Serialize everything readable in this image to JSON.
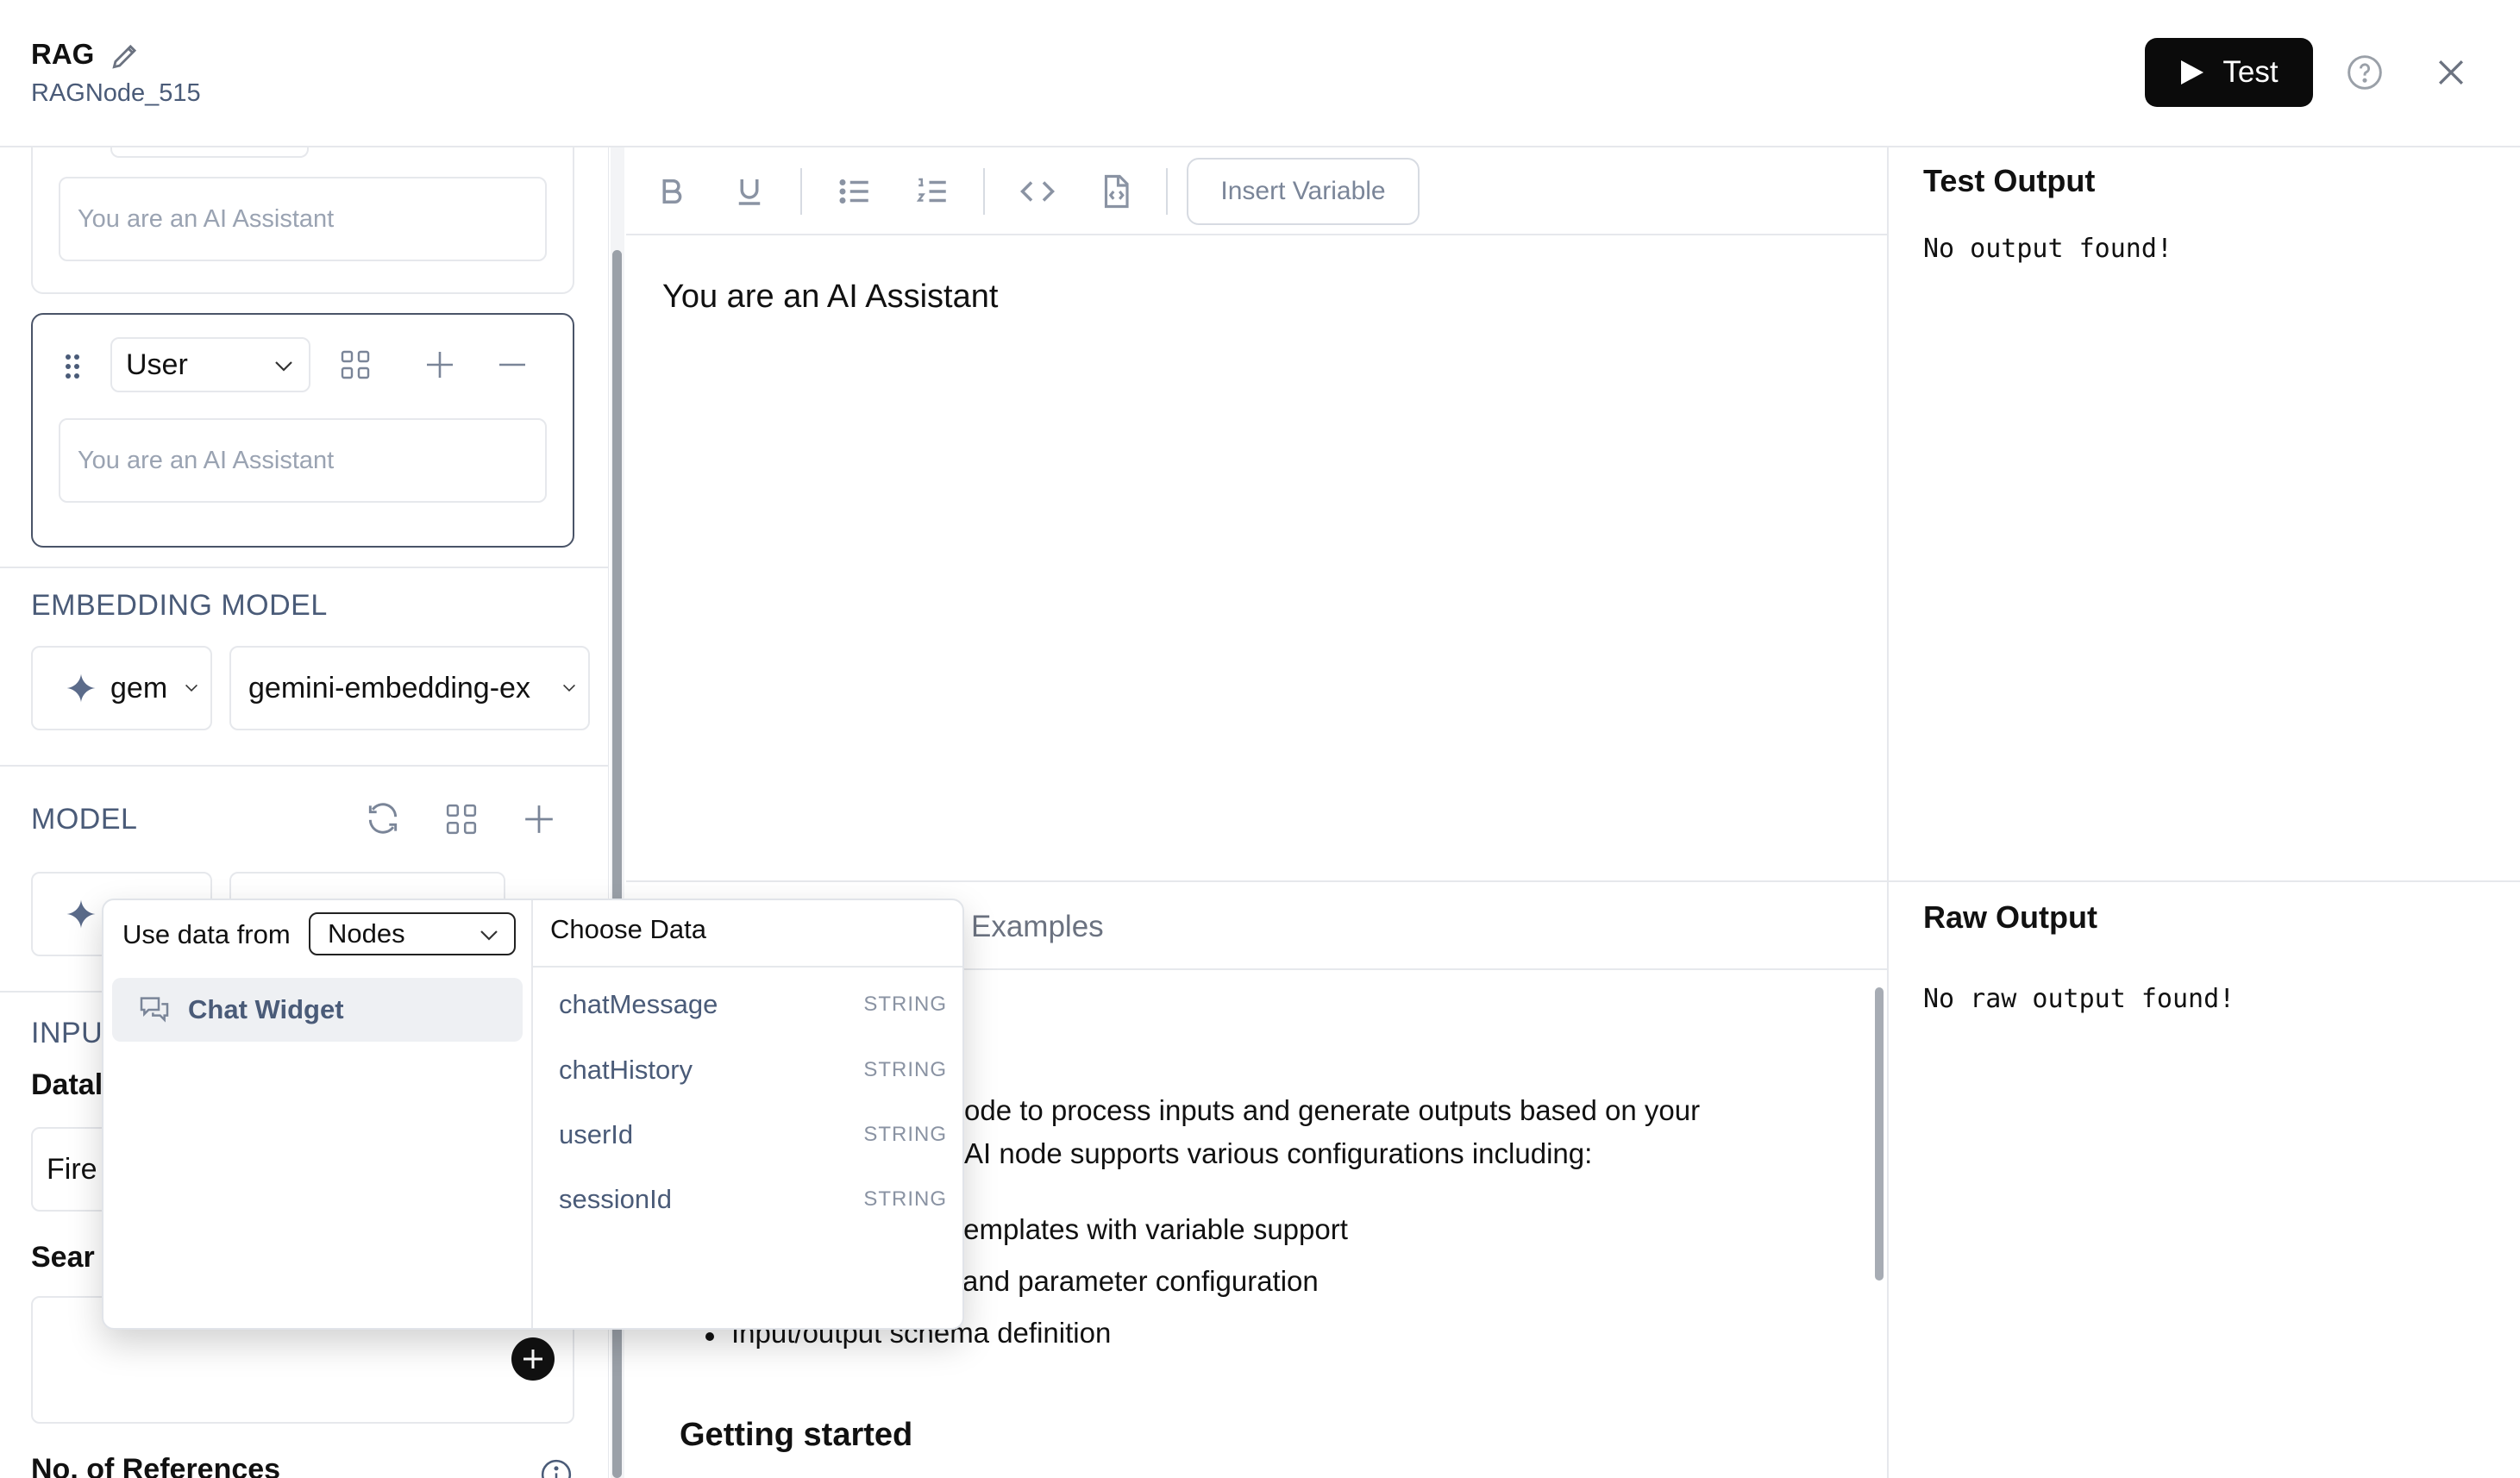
{
  "header": {
    "title": "RAG",
    "subtitle": "RAGNode_515",
    "test_label": "Test"
  },
  "left": {
    "system_message_placeholder": "You are an AI Assistant",
    "user_role": "User",
    "user_message_placeholder": "You are an AI Assistant",
    "embedding_label": "EMBEDDING MODEL",
    "embedding_provider": "gem",
    "embedding_model": "gemini-embedding-ex",
    "model_label": "MODEL",
    "inputs_label": "INPU",
    "datasource_label": "Datal",
    "datasource_value": "Fire",
    "search_label": "Sear",
    "references_label": "No. of References"
  },
  "editor": {
    "insert_variable": "Insert Variable",
    "content": "You are an AI Assistant"
  },
  "docs": {
    "tab_examples": "Examples",
    "line1": "ode to process inputs and generate outputs based on your",
    "line2": "AI node supports various configurations including:",
    "bullet1": "templates with variable support",
    "bullet2": "and parameter configuration",
    "bullet3": "Input/output schema definition",
    "heading_getting_started": "Getting started"
  },
  "output": {
    "test_title": "Test Output",
    "test_empty": "No output found!",
    "raw_title": "Raw Output",
    "raw_empty": "No raw output found!"
  },
  "popup": {
    "use_data_from": "Use data from",
    "source": "Nodes",
    "node": "Chat Widget",
    "choose_title": "Choose Data",
    "fields": [
      {
        "name": "chatMessage",
        "type": "STRING"
      },
      {
        "name": "chatHistory",
        "type": "STRING"
      },
      {
        "name": "userId",
        "type": "STRING"
      },
      {
        "name": "sessionId",
        "type": "STRING"
      }
    ]
  }
}
